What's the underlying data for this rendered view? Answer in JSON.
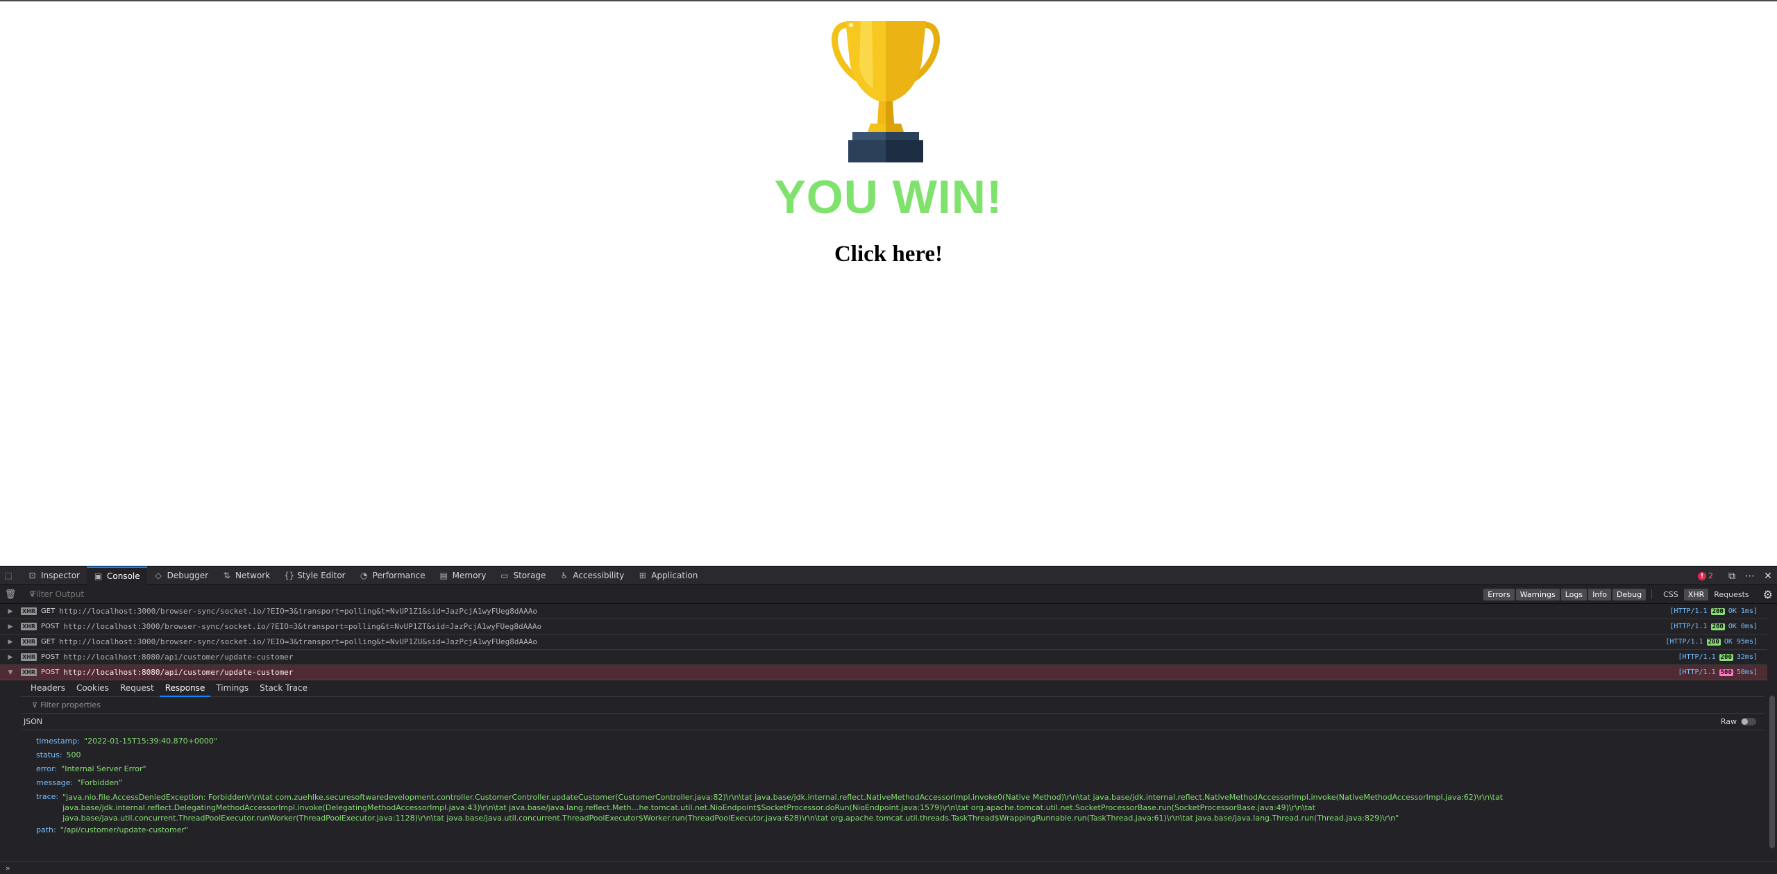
{
  "page": {
    "title": "YOU WIN!",
    "link": "Click here!"
  },
  "devtools": {
    "tabs": [
      {
        "label": "Inspector",
        "icon": "inspector-icon"
      },
      {
        "label": "Console",
        "icon": "console-icon"
      },
      {
        "label": "Debugger",
        "icon": "debugger-icon"
      },
      {
        "label": "Network",
        "icon": "network-icon"
      },
      {
        "label": "Style Editor",
        "icon": "style-editor-icon"
      },
      {
        "label": "Performance",
        "icon": "performance-icon"
      },
      {
        "label": "Memory",
        "icon": "memory-icon"
      },
      {
        "label": "Storage",
        "icon": "storage-icon"
      },
      {
        "label": "Accessibility",
        "icon": "accessibility-icon"
      },
      {
        "label": "Application",
        "icon": "application-icon"
      }
    ],
    "selected_tab": "Console",
    "error_count": "2",
    "filter_placeholder": "Filter Output",
    "filter_buttons": [
      "Errors",
      "Warnings",
      "Logs",
      "Info",
      "Debug"
    ],
    "type_buttons": [
      "CSS",
      "XHR",
      "Requests"
    ],
    "requests": [
      {
        "method": "GET",
        "url": "http://localhost:3000/browser-sync/socket.io/?EIO=3&transport=polling&t=NvUP1Z1&sid=JazPcjA1wyFUeg8dAAAo",
        "protocol": "[HTTP/1.1",
        "status": "200",
        "status_text": "OK 1ms]"
      },
      {
        "method": "POST",
        "url": "http://localhost:3000/browser-sync/socket.io/?EIO=3&transport=polling&t=NvUP1ZT&sid=JazPcjA1wyFUeg8dAAAo",
        "protocol": "[HTTP/1.1",
        "status": "200",
        "status_text": "OK 0ms]"
      },
      {
        "method": "GET",
        "url": "http://localhost:3000/browser-sync/socket.io/?EIO=3&transport=polling&t=NvUP1ZU&sid=JazPcjA1wyFUeg8dAAAo",
        "protocol": "[HTTP/1.1",
        "status": "200",
        "status_text": "OK 95ms]"
      },
      {
        "method": "POST",
        "url": "http://localhost:8080/api/customer/update-customer",
        "protocol": "[HTTP/1.1",
        "status": "200",
        "status_text": "32ms]"
      },
      {
        "method": "POST",
        "url": "http://localhost:8080/api/customer/update-customer",
        "protocol": "[HTTP/1.1",
        "status": "500",
        "status_text": "50ms]"
      }
    ],
    "detail_tabs": [
      "Headers",
      "Cookies",
      "Request",
      "Response",
      "Timings",
      "Stack Trace"
    ],
    "selected_detail_tab": "Response",
    "filter_properties": "Filter properties",
    "json_label": "JSON",
    "raw_label": "Raw",
    "response": {
      "timestamp_key": "timestamp:",
      "timestamp": "\"2022-01-15T15:39:40.870+0000\"",
      "status_key": "status:",
      "status": "500",
      "error_key": "error:",
      "error": "\"Internal Server Error\"",
      "message_key": "message:",
      "message": "\"Forbidden\"",
      "trace_key": "trace:",
      "trace": "\"java.nio.file.AccessDeniedException: Forbidden\\r\\n\\tat com.zuehlke.securesoftwaredevelopment.controller.CustomerController.updateCustomer(CustomerController.java:82)\\r\\n\\tat java.base/jdk.internal.reflect.NativeMethodAccessorImpl.invoke0(Native Method)\\r\\n\\tat java.base/jdk.internal.reflect.NativeMethodAccessorImpl.invoke(NativeMethodAccessorImpl.java:62)\\r\\n\\tat java.base/jdk.internal.reflect.DelegatingMethodAccessorImpl.invoke(DelegatingMethodAccessorImpl.java:43)\\r\\n\\tat java.base/java.lang.reflect.Meth…he.tomcat.util.net.NioEndpoint$SocketProcessor.doRun(NioEndpoint.java:1579)\\r\\n\\tat org.apache.tomcat.util.net.SocketProcessorBase.run(SocketProcessorBase.java:49)\\r\\n\\tat java.base/java.util.concurrent.ThreadPoolExecutor.runWorker(ThreadPoolExecutor.java:1128)\\r\\n\\tat java.base/java.util.concurrent.ThreadPoolExecutor$Worker.run(ThreadPoolExecutor.java:628)\\r\\n\\tat org.apache.tomcat.util.threads.TaskThread$WrappingRunnable.run(TaskThread.java:61)\\r\\n\\tat java.base/java.lang.Thread.run(Thread.java:829)\\r\\n\"",
      "path_key": "path:",
      "path": "\"/api/customer/update-customer\""
    },
    "prompt": "»"
  },
  "colors": {
    "win_green": "#7ee26c",
    "accent_blue": "#0a84ff",
    "error_row": "#4f2b33",
    "ok_badge": "#86de74",
    "error_badge": "#ff79c6"
  }
}
